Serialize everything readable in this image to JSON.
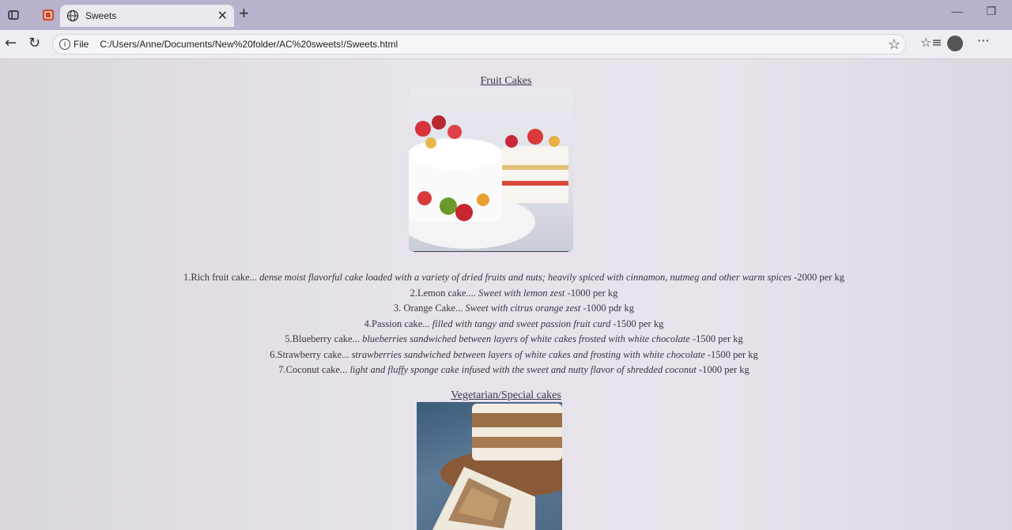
{
  "browser": {
    "tab_title": "Sweets",
    "url_scheme_label": "File",
    "url": "C:/Users/Anne/Documents/New%20folder/AC%20sweets!/Sweets.html",
    "new_tab_symbol": "+",
    "close_symbol": "✕",
    "more_symbol": "···"
  },
  "page": {
    "fruit_section_title": "Fruit Cakes",
    "veg_section_title": "Vegetarian/Special cakes",
    "cakes": [
      {
        "name": "1.Rich fruit cake...",
        "desc": " dense moist flavorful cake loaded with a variety of dried fruits and nuts; heavily spiced with cinnamon, nutmeg and other warm spices",
        "price": " -2000 per kg"
      },
      {
        "name": "2.Lemon cake....",
        "desc": " Sweet with lemon zest",
        "price": " -1000 per kg"
      },
      {
        "name": "3. Orange Cake...",
        "desc": " Sweet with citrus orange zest",
        "price": " -1000 pdr kg"
      },
      {
        "name": "4.Passion cake...",
        "desc": " filled with tangy and sweet passion fruit curd",
        "price": " -1500 per kg"
      },
      {
        "name": "5.Blueberry cake...",
        "desc": " blueberries sandwiched between layers of white cakes frosted with white chocolate",
        "price": " -1500 per kg"
      },
      {
        "name": "6.Strawberry cake...",
        "desc": " strawberries sandwiched between layers of white cakes and frosting with white chocolate",
        "price": " -1500 per kg"
      },
      {
        "name": "7.Coconut cake...",
        "desc": " light and fluffy sponge cake infused with the sweet and nutty flavor of shredded coconut",
        "price": " -1000 per kg"
      }
    ]
  }
}
